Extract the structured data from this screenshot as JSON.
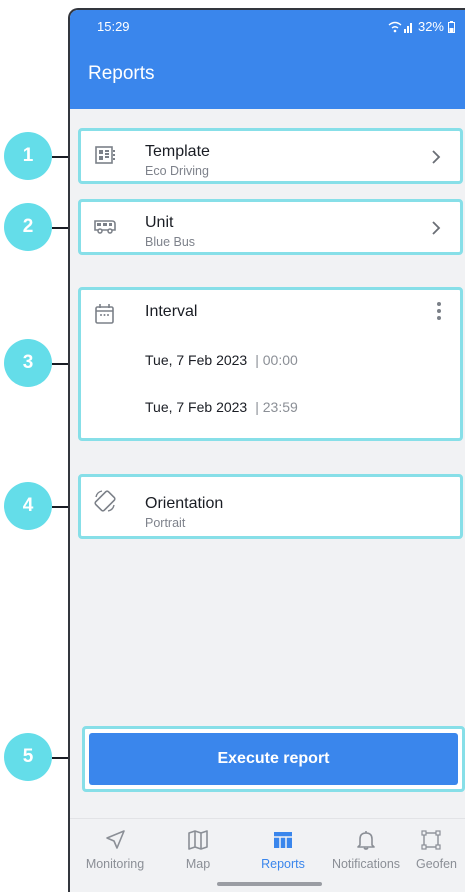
{
  "status": {
    "time": "15:29",
    "battery": "32%"
  },
  "appbar": {
    "title": "Reports"
  },
  "template": {
    "label": "Template",
    "value": "Eco Driving"
  },
  "unit": {
    "label": "Unit",
    "value": "Blue Bus"
  },
  "interval": {
    "label": "Interval",
    "from": {
      "date": "Tue, 7 Feb 2023",
      "time": "| 00:00"
    },
    "to": {
      "date": "Tue, 7 Feb 2023",
      "time": "| 23:59"
    }
  },
  "orientation": {
    "label": "Orientation",
    "value": "Portrait"
  },
  "execute": {
    "label": "Execute report"
  },
  "nav": {
    "monitoring": "Monitoring",
    "map": "Map",
    "reports": "Reports",
    "notifications": "Notifications",
    "geofences": "Geofen"
  },
  "callouts": [
    "1",
    "2",
    "3",
    "4",
    "5"
  ],
  "colors": {
    "accent": "#3a86ec",
    "callout": "#64dde9",
    "highlight": "#87dfe8"
  }
}
